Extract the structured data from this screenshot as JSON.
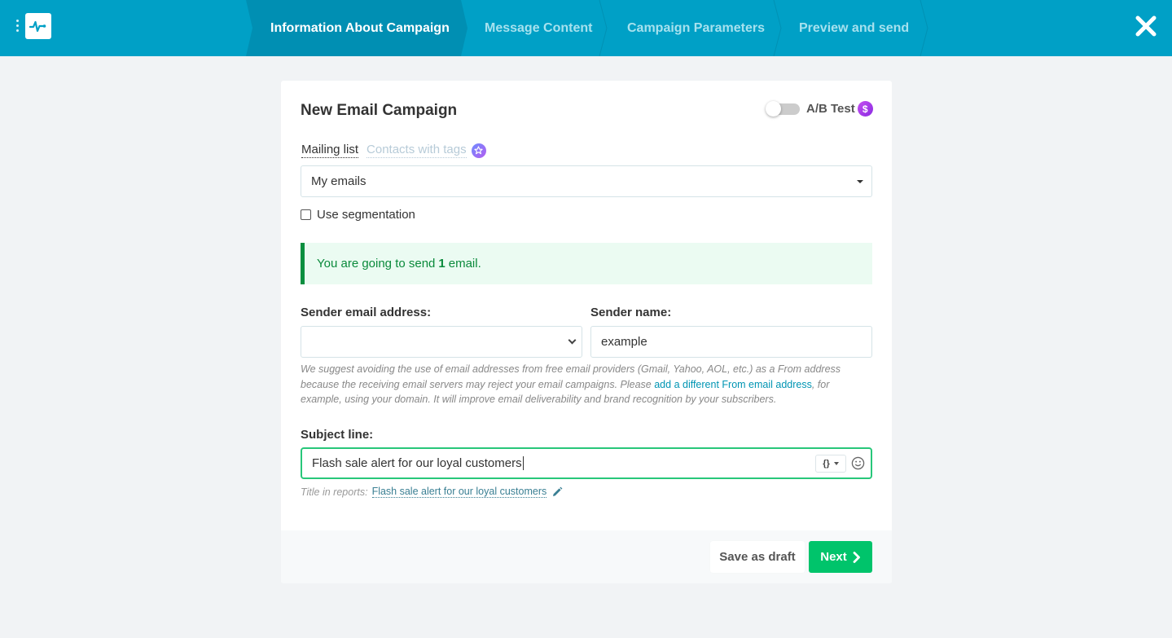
{
  "header": {
    "steps": [
      {
        "label": "Information About Campaign",
        "active": true
      },
      {
        "label": "Message Content",
        "active": false
      },
      {
        "label": "Campaign Parameters",
        "active": false
      },
      {
        "label": "Preview and send",
        "active": false
      }
    ],
    "icons": {
      "menu": "vertical-dots-icon",
      "logo": "pulse-logo-icon",
      "close": "close-icon"
    }
  },
  "colors": {
    "header_bg": "#00a0c6",
    "active_step_bg": "#008fb3",
    "success": "#00c46b",
    "alert_green": "#0a8a3b",
    "link": "#0095b3"
  },
  "card": {
    "title": "New Email Campaign",
    "ab_test": {
      "label": "A/B Test",
      "enabled": false,
      "badge": "$"
    },
    "audience_tabs": [
      {
        "label": "Mailing list",
        "active": true
      },
      {
        "label": "Contacts with tags",
        "active": false
      }
    ],
    "mailing_list": {
      "selected": "My emails"
    },
    "segmentation": {
      "label": "Use segmentation",
      "checked": false
    },
    "alert": {
      "prefix": "You are going to send",
      "count": "1",
      "suffix": "email."
    },
    "sender_email": {
      "label": "Sender email address:",
      "value": ""
    },
    "sender_name": {
      "label": "Sender name:",
      "value": "example"
    },
    "hint": {
      "part1": "We suggest avoiding the use of email addresses from free email providers (Gmail, Yahoo, AOL, etc.) as a From address because the receiving email servers may reject your email campaigns. Please",
      "link": "add a different From email address",
      "part2": ", for example, using your domain. It will improve email deliverability and brand recognition by your subscribers."
    },
    "subject": {
      "label": "Subject line:",
      "value": "Flash sale alert for our loyal customers",
      "variables_button": "{}"
    },
    "reports_title": {
      "label": "Title in reports:",
      "value": "Flash sale alert for our loyal customers"
    }
  },
  "footer": {
    "save_draft": "Save as draft",
    "next": "Next"
  }
}
